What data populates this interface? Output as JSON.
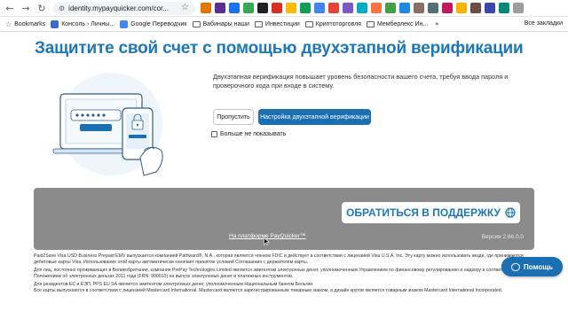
{
  "browser": {
    "url": "identity.mypayquicker.com/cor...",
    "bookmarks": [
      {
        "label": "Bookmarks",
        "type": "star",
        "color": "#5f6368"
      },
      {
        "label": "Консоль › Личны...",
        "type": "site",
        "color": "#3a6cc9"
      },
      {
        "label": "Google Переводчик",
        "type": "site",
        "color": "#4285f4"
      },
      {
        "label": "Вабинары наши",
        "type": "folder"
      },
      {
        "label": "Инвестиции",
        "type": "folder"
      },
      {
        "label": "Криптоторговля",
        "type": "folder"
      },
      {
        "label": "Мемберлекс Ин...",
        "type": "folder"
      }
    ],
    "all_bookmarks": "Все закладки"
  },
  "page": {
    "title": "Защитите свой счет с помощью двухэтапной верификации",
    "description": "Двухэтапная верификация повышает уровень безопасности вашего счета, требуя ввода пароля и проверочного кода при входе в систему.",
    "skip_label": "Пропустить",
    "setup_label": "Настройка двухэтапной верификации",
    "dont_show_label": "Больше не показывать",
    "support_label": "ОБРАТИТЬСЯ В ПОДДЕРЖКУ",
    "platform_label": "На платформе PayQuicker™",
    "version": "Версия 2.66.0.0",
    "legal": [
      "Paid2Save Visa USD Business Prepaid EMV выпускается компанией Pathward®, N.A., которая является членом FDIC и действует в соответствии с лицензией Visa U.S.A. Inc. Эту карту можно использовать везде, где принимаются дебетовые карты Visa. Использование этой карты автоматически означает принятие условий Соглашения с держателем карты.",
      "Для лиц, постоянно проживающих в Великобритании, компания PrePay Technologies Limited является эмитентом электронных денег, уполномоченным Управлением по финансовому регулированию и надзору в соответствии с Положением об электронных деньгах 2011 года (FRN: 900010) на выпуск электронных денег и платежных инструментов.",
      "Для резидентов ЕС и ЕЭП, PPS EU SA является эмитентом электронных денег, уполномоченным Национальным банком Бельгии.",
      "Все карты выпускаются в соответствии с лицензией Mastercard International. Mastercard является зарегистрированным товарным знаком, а дизайн кругов является товарным знаком Mastercard International Incorporated."
    ],
    "help_label": "Помощь"
  },
  "colors": {
    "accent": "#1d78b5",
    "button": "#1a6fb2",
    "panel": "#8b8b8b"
  }
}
